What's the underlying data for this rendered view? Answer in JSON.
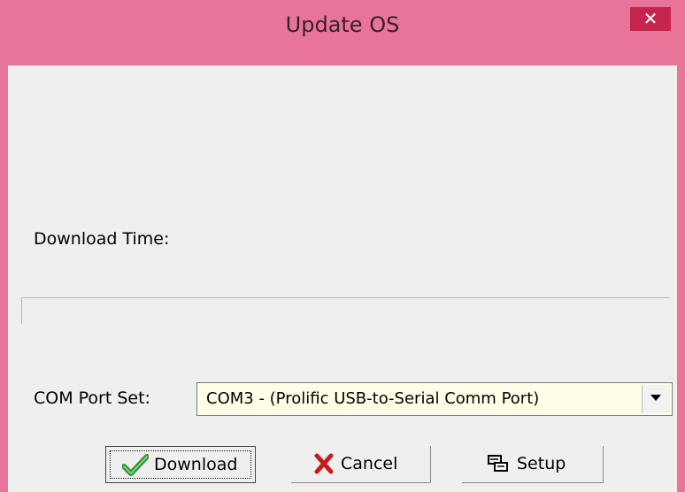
{
  "window": {
    "title": "Update OS",
    "close_glyph": "✕",
    "accent_color": "#e8749a",
    "close_color": "#c7254f"
  },
  "download_time": {
    "label": "Download Time:"
  },
  "progress": {
    "value": 0
  },
  "com_port": {
    "label": "COM Port Set:",
    "selected": "COM3 - (Prolific USB-to-Serial Comm Port)"
  },
  "buttons": {
    "download": {
      "label": "Download",
      "icon": "checkmark-icon"
    },
    "cancel": {
      "label": "Cancel",
      "icon": "x-icon"
    },
    "setup": {
      "label": "Setup",
      "icon": "setup-icon"
    }
  }
}
